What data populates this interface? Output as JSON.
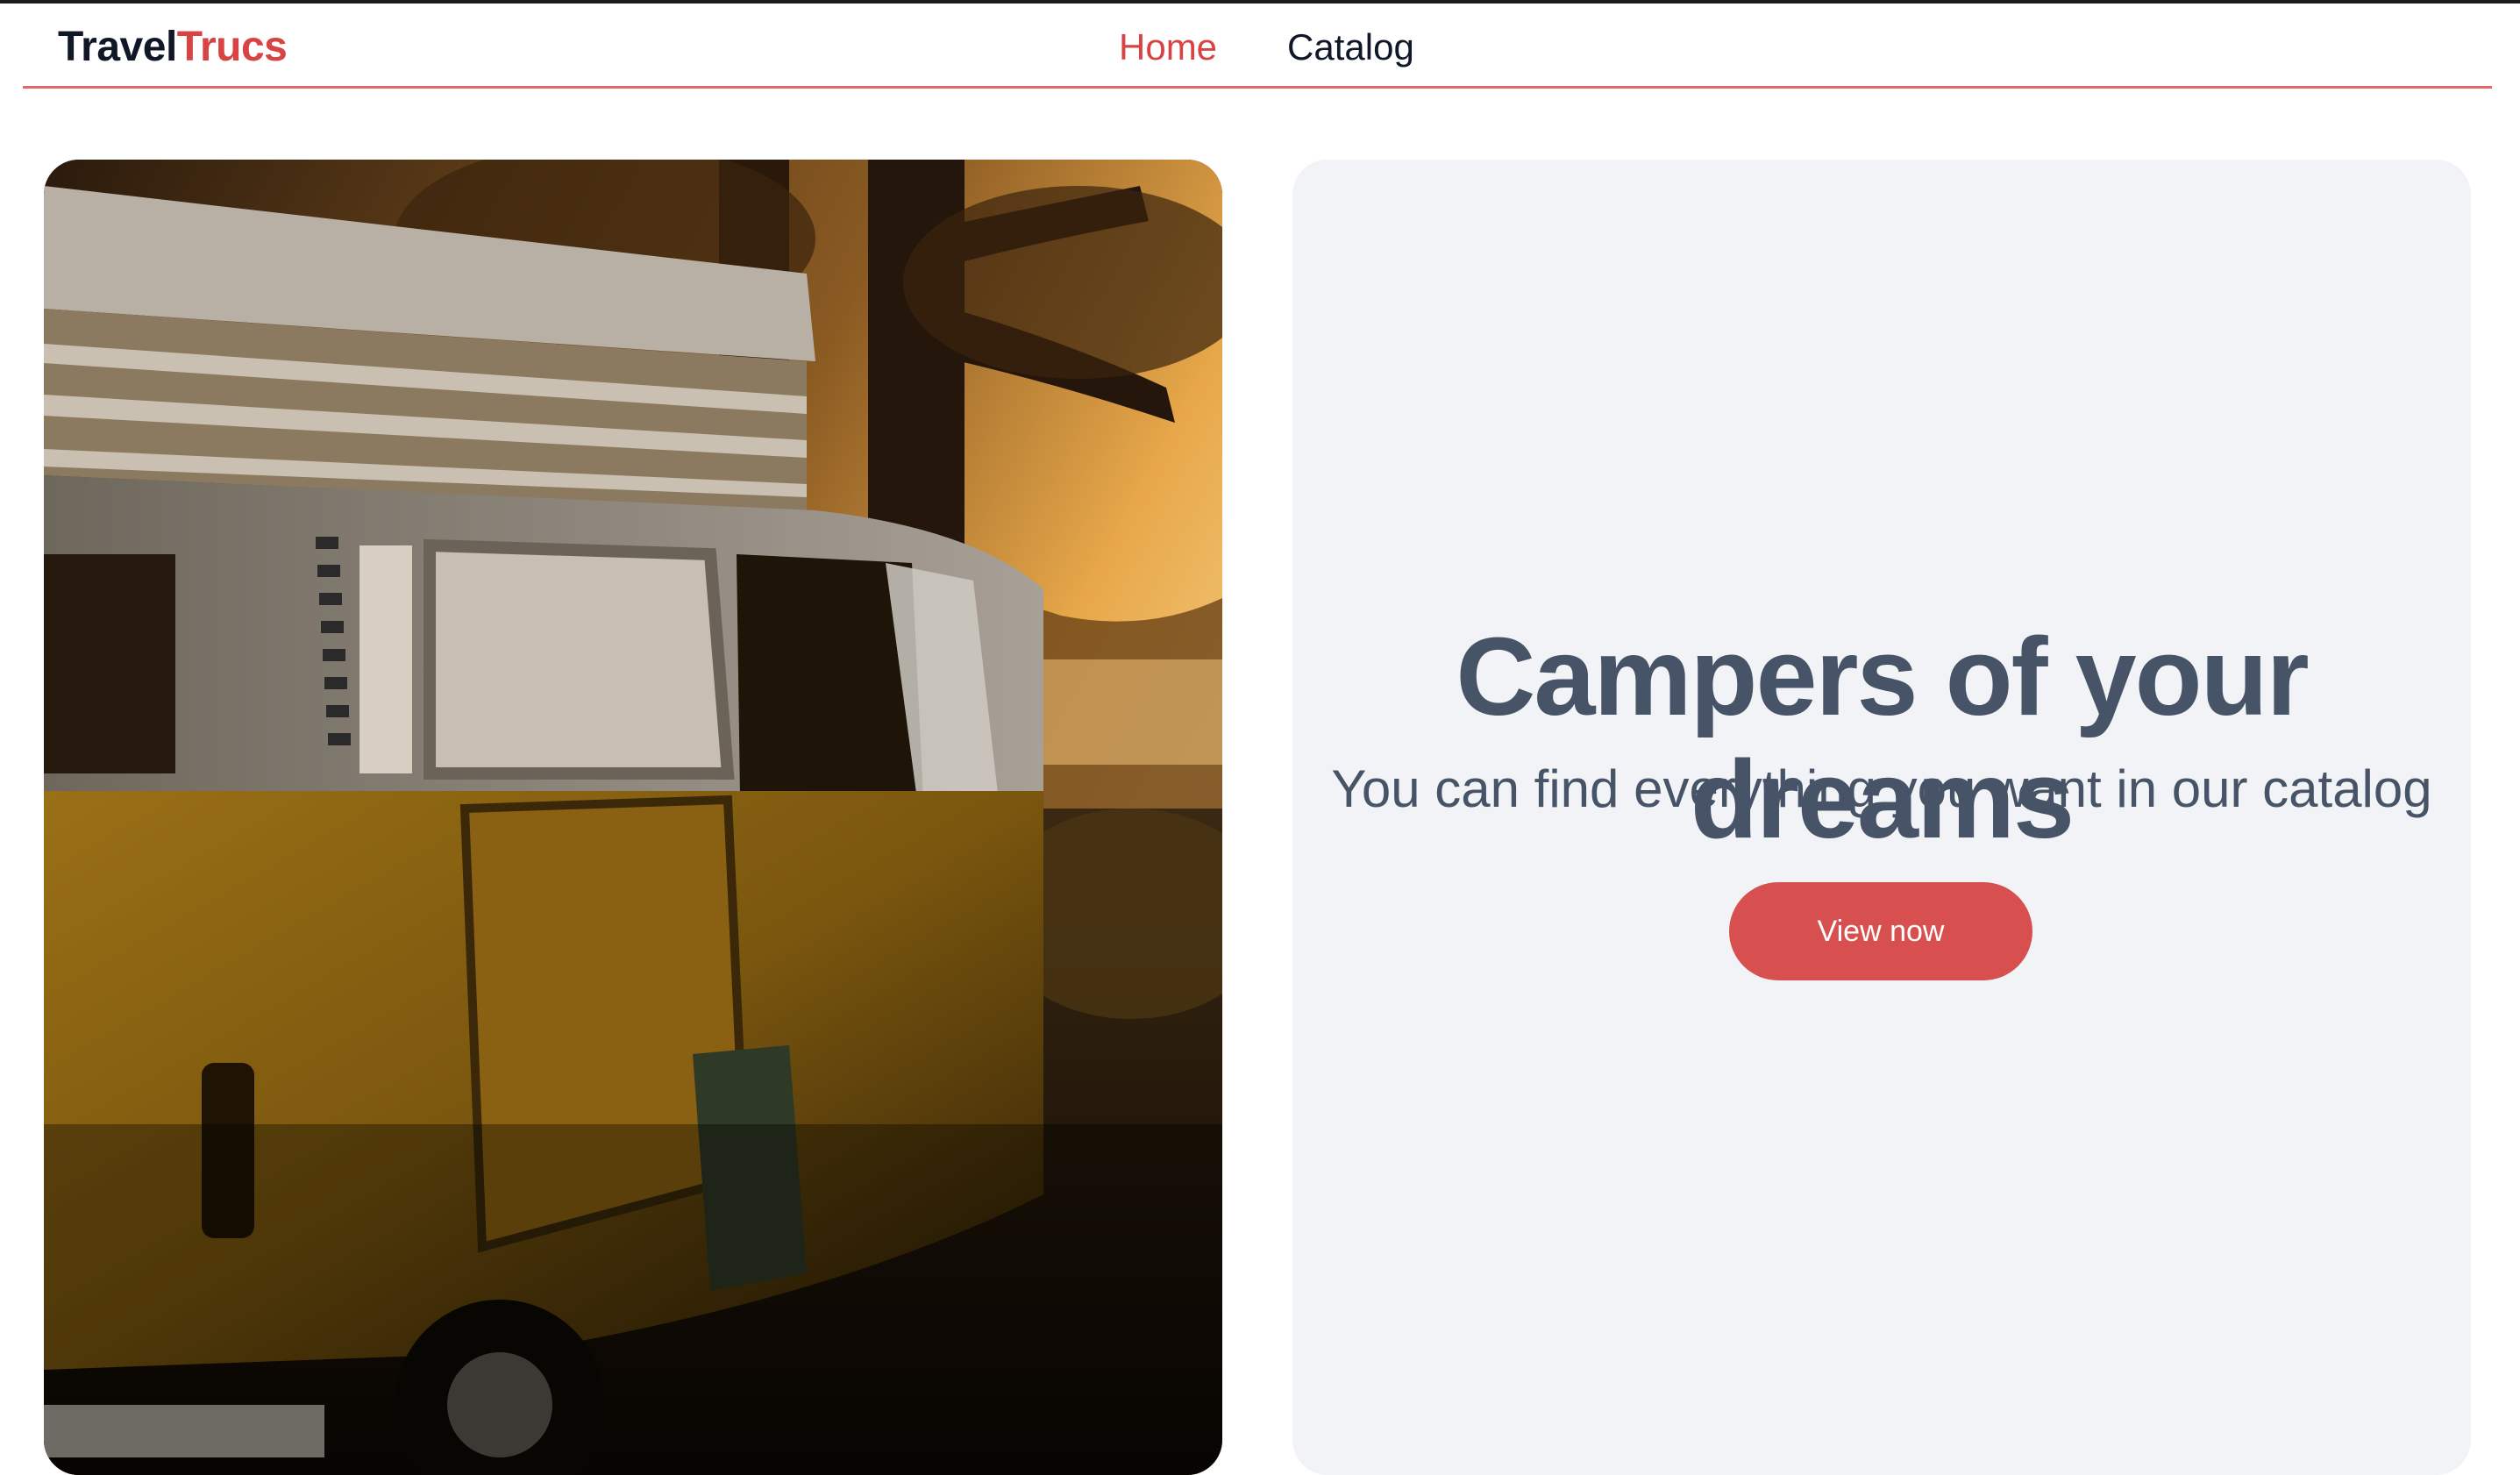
{
  "header": {
    "logo_part1": "Travel",
    "logo_part2": "Trucs",
    "nav": [
      {
        "label": "Home",
        "active": true
      },
      {
        "label": "Catalog",
        "active": false
      }
    ]
  },
  "hero": {
    "title": "Campers of your dreams",
    "subtitle": "You can find everything you want in our catalog",
    "cta_label": "View now"
  },
  "colors": {
    "accent": "#d84343",
    "text_dark": "#101828",
    "text_muted": "#475467",
    "panel_bg": "#f2f3f6",
    "button_bg": "#d84f4f"
  }
}
